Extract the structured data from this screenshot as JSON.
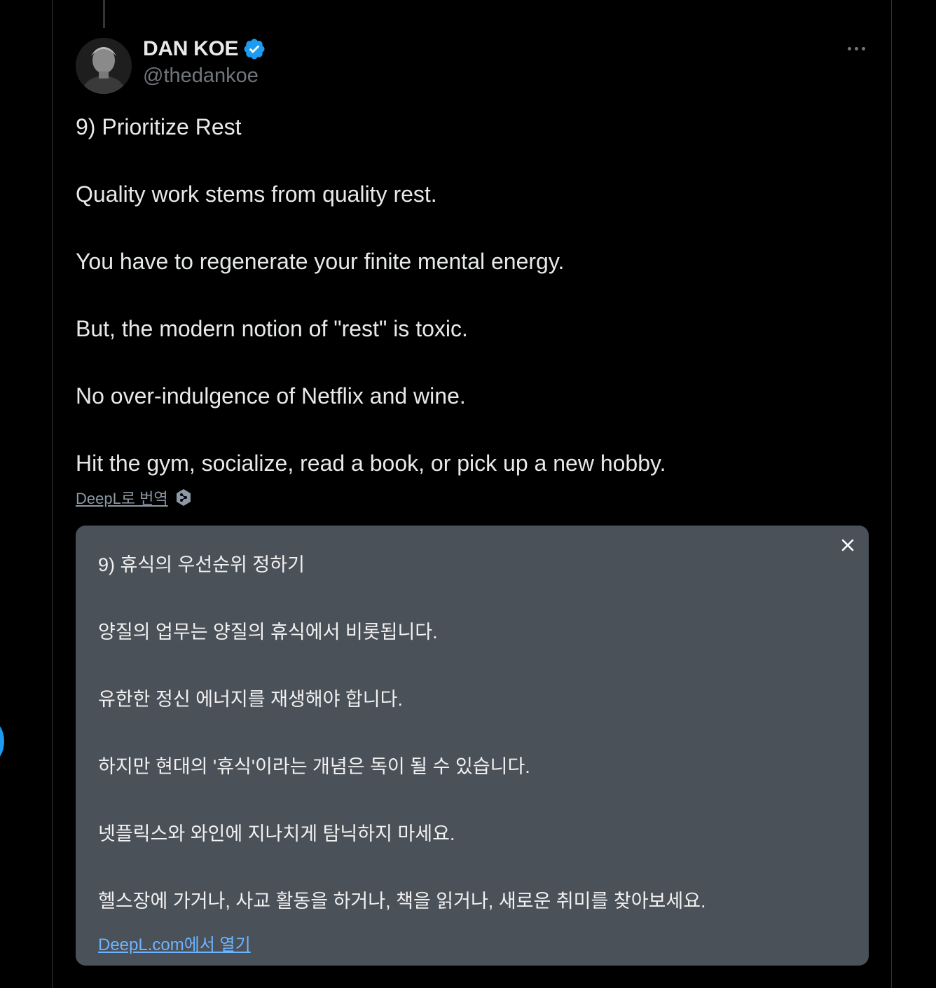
{
  "user": {
    "name": "DAN KOE",
    "handle": "@thedankoe",
    "verified_color": "#1d9bf0"
  },
  "tweet": {
    "lines": [
      "9) Prioritize Rest",
      "Quality work stems from quality rest.",
      "You have to regenerate your finite mental energy.",
      "But, the modern notion of \"rest\" is toxic.",
      "No over-indulgence of Netflix and wine.",
      "Hit the gym, socialize, read a book, or pick up a new hobby."
    ]
  },
  "deepl": {
    "translate_link": "DeepL로 번역",
    "translation_lines": [
      "9) 휴식의 우선순위 정하기",
      "양질의 업무는 양질의 휴식에서 비롯됩니다.",
      "유한한 정신 에너지를 재생해야 합니다.",
      "하지만 현대의 '휴식'이라는 개념은 독이 될 수 있습니다.",
      "넷플릭스와 와인에 지나치게 탐닉하지 마세요.",
      "헬스장에 가거나, 사교 활동을 하거나, 책을 읽거나, 새로운 취미를 찾아보세요."
    ],
    "open_link": "DeepL.com에서 열기",
    "box_color": "#4b5159",
    "link_color": "#6cb4ff"
  },
  "icons": {
    "verified": "verified-badge-icon",
    "more": "more-horizontal-icon",
    "close": "close-icon",
    "deepl": "deepl-logo-icon"
  }
}
